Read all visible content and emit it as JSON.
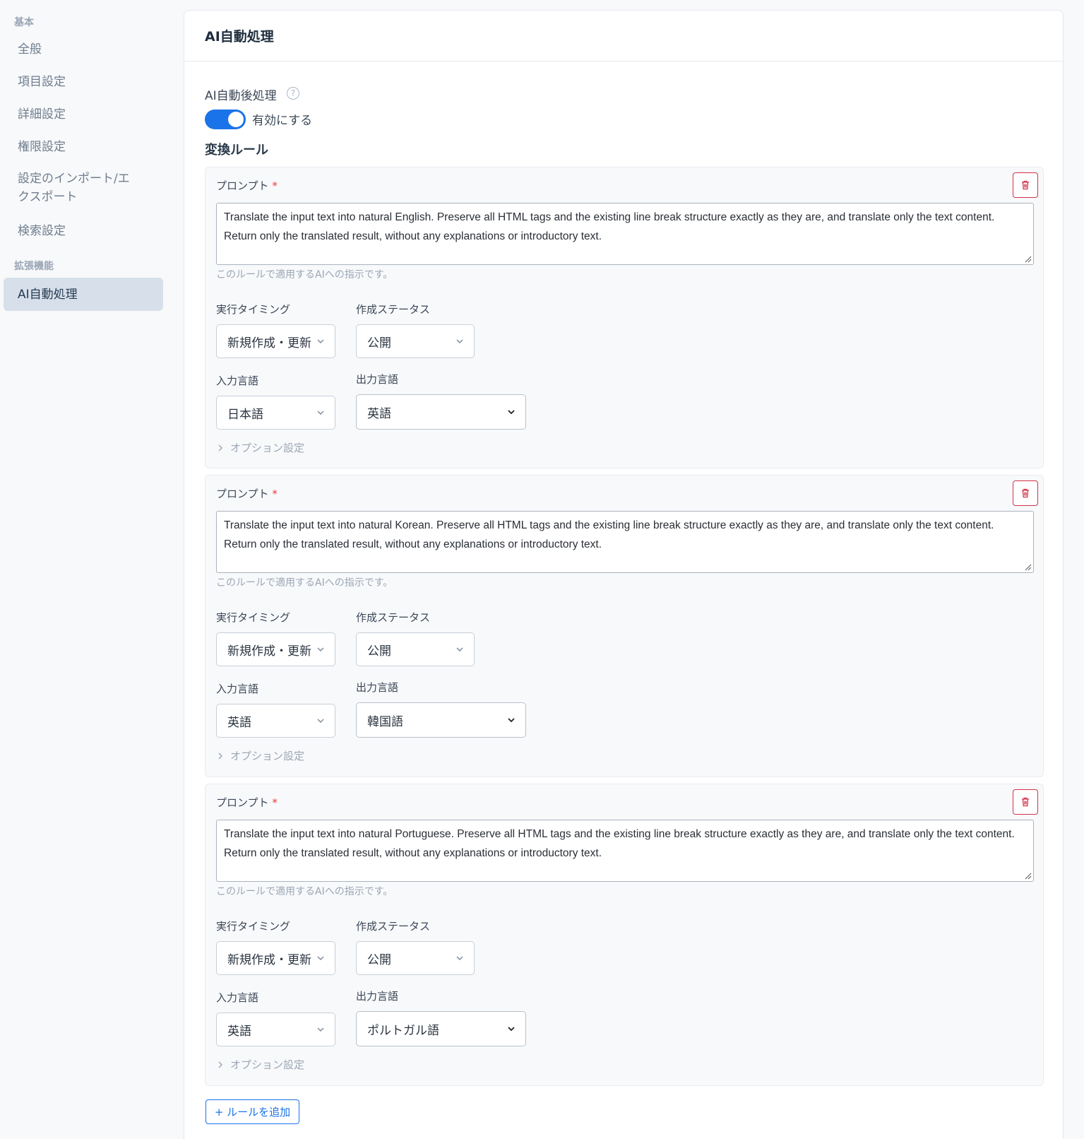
{
  "sidebar": {
    "section_basic": "基本",
    "items": [
      {
        "label": "全般"
      },
      {
        "label": "項目設定"
      },
      {
        "label": "詳細設定"
      },
      {
        "label": "権限設定"
      },
      {
        "label_line1": "設定のインポート/エ",
        "label_line2": "クスポート"
      },
      {
        "label": "検索設定"
      }
    ],
    "section_ext": "拡張機能",
    "active_item": "AI自動処理"
  },
  "panel": {
    "title": "AI自動処理",
    "post_process_label": "AI自動後処理",
    "help_icon": "?",
    "toggle_label": "有効にする",
    "toggle_on": true,
    "rules_heading": "変換ルール",
    "add_rule_label": "+ ルールを追加"
  },
  "common": {
    "prompt_label": "プロンプト",
    "required_mark": "*",
    "prompt_help": "このルールで適用するAIへの指示です。",
    "timing_label": "実行タイミング",
    "status_label": "作成ステータス",
    "input_lang_label": "入力言語",
    "output_lang_label": "出力言語",
    "options_label": "オプション設定"
  },
  "rules": [
    {
      "prompt_line1": "Translate the input text into natural English. Preserve all HTML tags and the existing line break structure exactly as they are, and translate only the text content.",
      "prompt_line2": "Return only the translated result, without any explanations or introductory text.",
      "timing": "新規作成・更新",
      "status": "公開",
      "input_lang": "日本語",
      "output_lang": "英語"
    },
    {
      "prompt_line1": "Translate the input text into natural Korean. Preserve all HTML tags and the existing line break structure exactly as they are, and translate only the text content.",
      "prompt_line2": "Return only the translated result, without any explanations or introductory text.",
      "timing": "新規作成・更新",
      "status": "公開",
      "input_lang": "英語",
      "output_lang": "韓国語"
    },
    {
      "prompt_line1": "Translate the input text into natural Portuguese. Preserve all HTML tags and the existing line break structure exactly as they are, and translate only the text content.",
      "prompt_line2": "Return only the translated result, without any explanations or introductory text.",
      "timing": "新規作成・更新",
      "status": "公開",
      "input_lang": "英語",
      "output_lang": "ポルトガル語"
    }
  ],
  "colors": {
    "accent": "#1a73e8",
    "danger": "#d0334a",
    "active_bg": "#d7e0ea"
  }
}
